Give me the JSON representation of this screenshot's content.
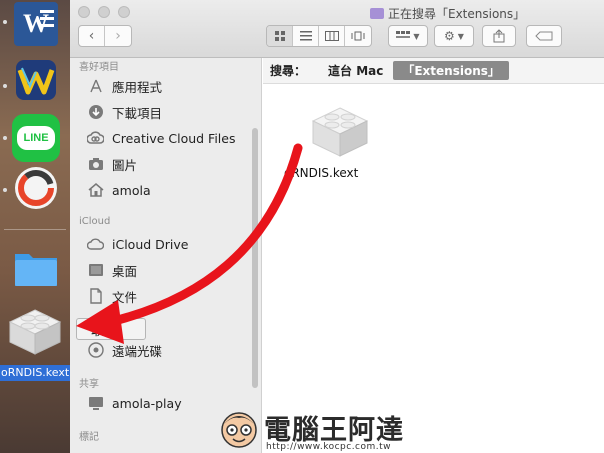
{
  "window": {
    "title": "正在搜尋「Extensions」"
  },
  "sidebar": {
    "favorites_header": "喜好項目",
    "favorites": [
      {
        "label": "應用程式",
        "icon": "applications-icon"
      },
      {
        "label": "下載項目",
        "icon": "downloads-icon"
      },
      {
        "label": "Creative Cloud Files",
        "icon": "creative-cloud-icon"
      },
      {
        "label": "圖片",
        "icon": "camera-icon"
      },
      {
        "label": "amola",
        "icon": "home-icon"
      }
    ],
    "icloud_header": "iCloud",
    "icloud": [
      {
        "label": "iCloud Drive",
        "icon": "cloud-icon"
      },
      {
        "label": "桌面",
        "icon": "desktop-icon"
      },
      {
        "label": "文件",
        "icon": "document-icon"
      }
    ],
    "devices": [
      {
        "label": "遠端光碟",
        "icon": "disc-icon"
      }
    ],
    "shared_header": "共享",
    "shared": [
      {
        "label": "amola-play",
        "icon": "display-icon"
      }
    ],
    "tags_header": "標記"
  },
  "search": {
    "label": "搜尋：",
    "scope": "這台 Mac",
    "term": "「Extensions」"
  },
  "files": [
    {
      "name": "HoRNDIS.kext",
      "visible_name": "oRNDIS.kext",
      "icon": "kext-bundle-icon"
    }
  ],
  "dock": {
    "dragged_label": "oRNDIS.kext"
  },
  "drag_tooltip": "取消",
  "drag_tooltip_visible": "取補",
  "watermark": {
    "title": "電腦王阿達",
    "url": "http://www.kocpc.com.tw"
  },
  "colors": {
    "accent_red": "#e8141b",
    "dock_label_blue": "#2f6fd6"
  }
}
